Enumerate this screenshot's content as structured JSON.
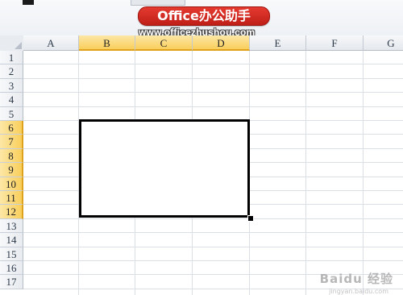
{
  "watermark": {
    "brand": "Office办公助手",
    "url": "www.officezhushou.com"
  },
  "columns": [
    "A",
    "B",
    "C",
    "D",
    "E",
    "F",
    "G"
  ],
  "selected_columns": [
    "B",
    "C",
    "D"
  ],
  "rows": [
    "1",
    "2",
    "3",
    "4",
    "5",
    "6",
    "7",
    "8",
    "9",
    "10",
    "11",
    "12",
    "13",
    "14",
    "15",
    "16",
    "17"
  ],
  "selected_rows": [
    "6",
    "7",
    "8",
    "9",
    "10",
    "11",
    "12"
  ],
  "selection": {
    "range": "B6:D12",
    "border": "thick-box"
  },
  "colors": {
    "header_highlight": "#f9cf5c",
    "grid_line": "#dadfe6",
    "brand_red": "#d52a22"
  },
  "icons": [
    "fill-handle-icon",
    "baidu-watermark-icon"
  ]
}
